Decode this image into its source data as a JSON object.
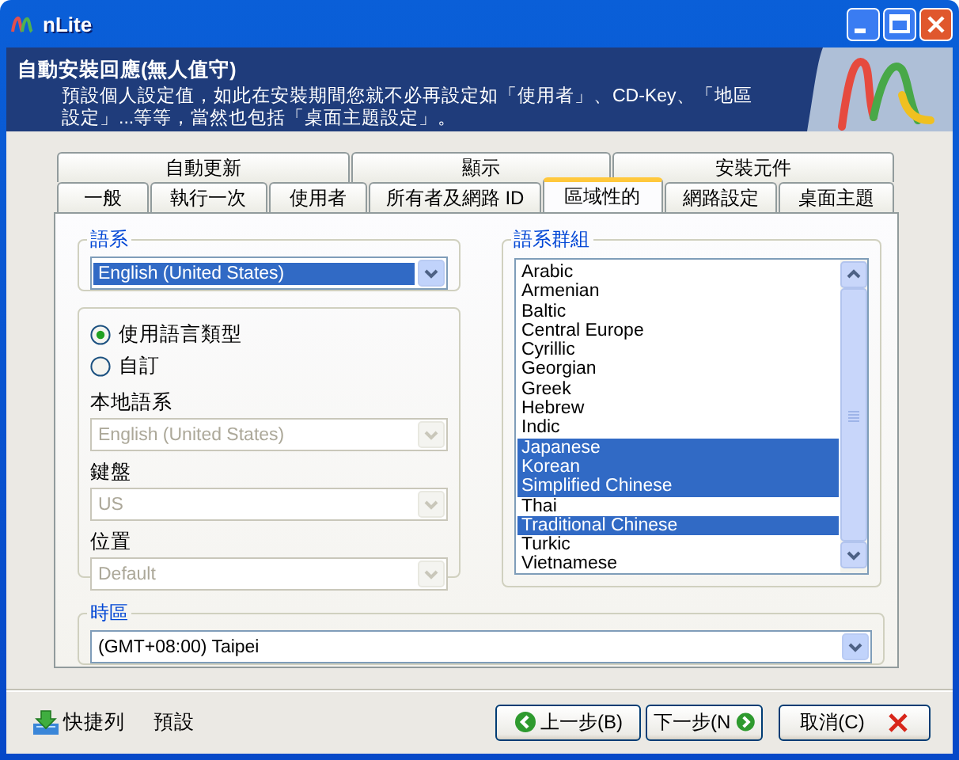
{
  "window": {
    "title": "nLite"
  },
  "header": {
    "title": "自動安裝回應(無人值守)",
    "description": "預設個人設定值，如此在安裝期間您就不必再設定如「使用者」、CD-Key、「地區設定」...等等，當然也包括「桌面主題設定」。"
  },
  "tab_rows": [
    [
      {
        "label": "自動更新",
        "selected": false
      },
      {
        "label": "顯示",
        "selected": false
      },
      {
        "label": "安裝元件",
        "selected": false
      }
    ],
    [
      {
        "label": "一般",
        "selected": false
      },
      {
        "label": "執行一次",
        "selected": false
      },
      {
        "label": "使用者",
        "selected": false
      },
      {
        "label": "所有者及網路 ID",
        "selected": false
      },
      {
        "label": "區域性的",
        "selected": true
      },
      {
        "label": "網路設定",
        "selected": false
      },
      {
        "label": "桌面主題",
        "selected": false
      }
    ]
  ],
  "locale": {
    "legend": "語系",
    "value": "English (United States)",
    "selected": true
  },
  "input": {
    "options": [
      {
        "label": "使用語言類型",
        "selected": true
      },
      {
        "label": "自訂",
        "selected": false
      }
    ],
    "fields": [
      {
        "label": "本地語系",
        "value": "English (United States)",
        "disabled": true
      },
      {
        "label": "鍵盤",
        "value": "US",
        "disabled": true
      },
      {
        "label": "位置",
        "value": "Default",
        "disabled": true
      }
    ]
  },
  "language_groups": {
    "legend": "語系群組",
    "items": [
      {
        "label": "Arabic",
        "selected": false
      },
      {
        "label": "Armenian",
        "selected": false
      },
      {
        "label": "Baltic",
        "selected": false
      },
      {
        "label": "Central Europe",
        "selected": false
      },
      {
        "label": "Cyrillic",
        "selected": false
      },
      {
        "label": "Georgian",
        "selected": false
      },
      {
        "label": "Greek",
        "selected": false
      },
      {
        "label": "Hebrew",
        "selected": false
      },
      {
        "label": "Indic",
        "selected": false
      },
      {
        "label": "Japanese",
        "selected": true
      },
      {
        "label": "Korean",
        "selected": true
      },
      {
        "label": "Simplified Chinese",
        "selected": true
      },
      {
        "label": "Thai",
        "selected": false
      },
      {
        "label": "Traditional Chinese",
        "selected": true
      },
      {
        "label": "Turkic",
        "selected": false
      },
      {
        "label": "Vietnamese",
        "selected": false
      }
    ]
  },
  "time_zone": {
    "legend": "時區",
    "value": "(GMT+08:00) Taipei"
  },
  "footer": {
    "links": [
      {
        "label": "快捷列",
        "kind": "download"
      },
      {
        "label": "預設",
        "kind": "plain"
      }
    ],
    "buttons": [
      {
        "label": "上一步(B)",
        "kind": "back"
      },
      {
        "label": "下一步(N",
        "kind": "next"
      },
      {
        "label": "取消(C)",
        "kind": "cancel"
      }
    ]
  }
}
